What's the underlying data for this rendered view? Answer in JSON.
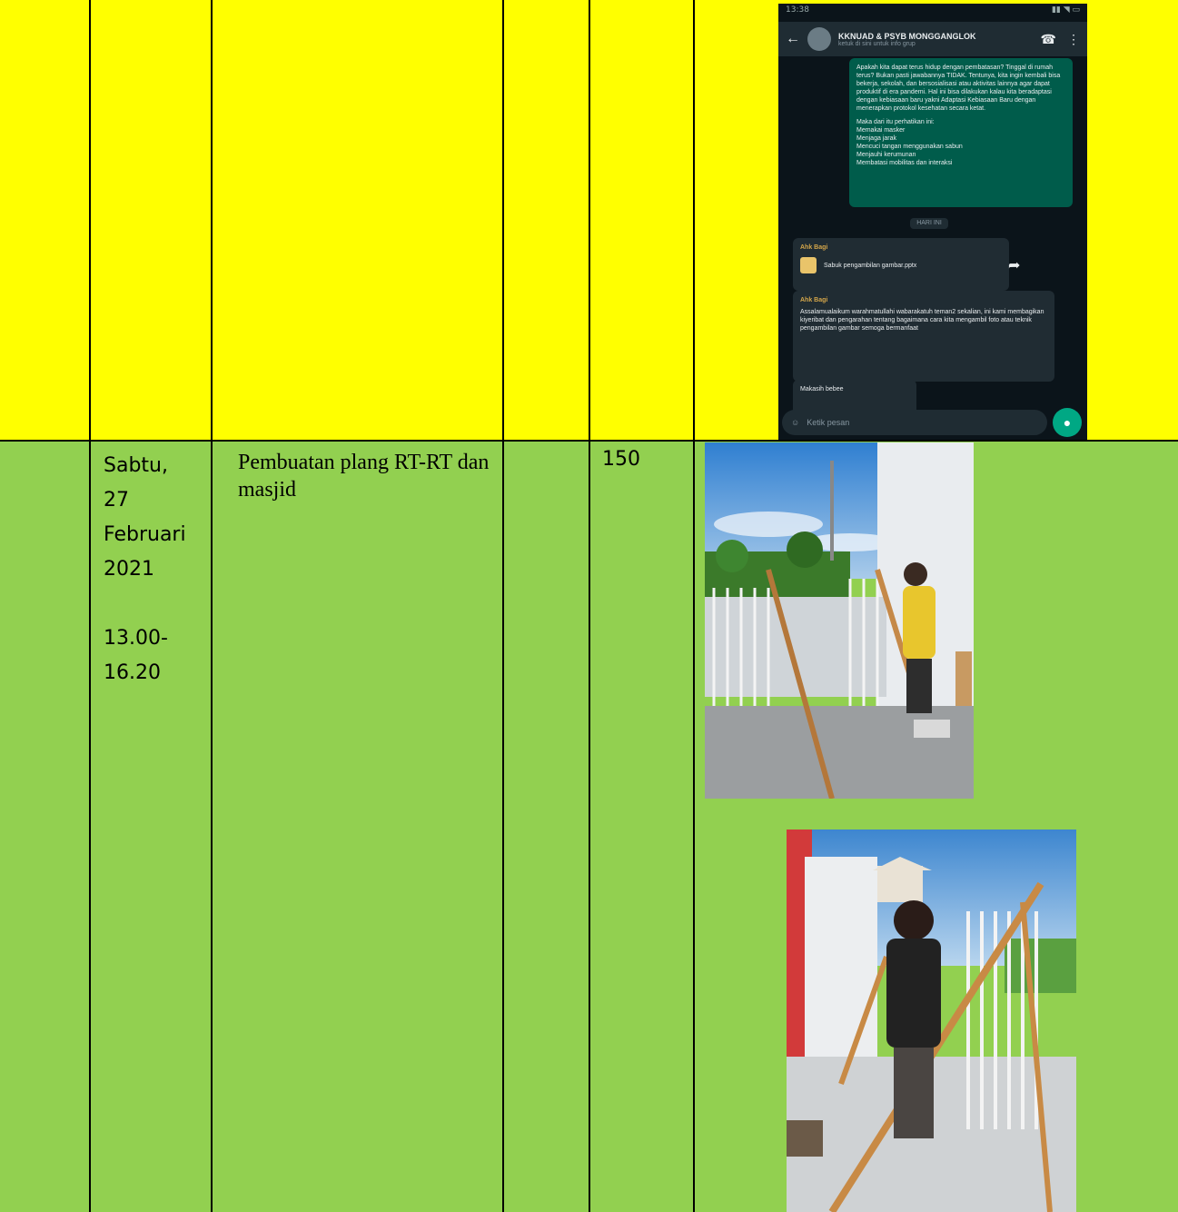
{
  "rows": [
    {
      "color": "#ffff00",
      "photo": {
        "type": "whatsapp-screenshot",
        "group_title": "KKNUAD & PSYB MONGGANGLOK",
        "group_subtitle": "ketuk di sini untuk info grup",
        "status_time": "13:38",
        "message_main": "Apakah kita dapat terus hidup dengan pembatasan? Tinggal di rumah terus? Bukan pasti jawabannya TIDAK. Tentunya, kita ingin kembali bisa bekerja, sekolah, dan bersosialisasi atau aktivitas lainnya agar dapat produktif di era pandemi. Hal ini bisa dilakukan kalau kita beradaptasi dengan kebiasaan baru yakni Adaptasi Kebiasaan Baru dengan menerapkan protokol kesehatan secara ketat.",
        "message_list_intro": "Maka dari itu perhatikan ini:",
        "message_list": [
          "Memakai masker",
          "Menjaga jarak",
          "Mencuci tangan menggunakan sabun",
          "Menjauhi kerumunan",
          "Membatasi mobilitas dan interaksi"
        ],
        "date_pill": "HARI INI",
        "file_sender": "Ahk Bagi",
        "file_name": "Sabuk pengambilan gambar.pptx",
        "reply_sender": "Ahk Bagi",
        "reply_message": "Assalamualaikum warahmatullahi wabarakatuh teman2 sekalian, ini kami membagikan kiyeribat dan pengarahan tentang bagaimana cara kita mengambil foto atau teknik pengambilan gambar semoga bermanfaat",
        "short_reply": "Makasih bebee",
        "input_placeholder": "Ketik pesan"
      }
    },
    {
      "color": "#92d050",
      "date_lines": [
        "Sabtu,",
        "27",
        "Februari",
        "2021"
      ],
      "time_lines": [
        "13.00-",
        "16.20"
      ],
      "activity": "Pembuatan plang RT-RT dan masjid",
      "value": "150",
      "photos": [
        {
          "alt": "man-cutting-wood-near-gate-photo"
        },
        {
          "alt": "boy-holding-wooden-frame-photo"
        }
      ]
    }
  ]
}
